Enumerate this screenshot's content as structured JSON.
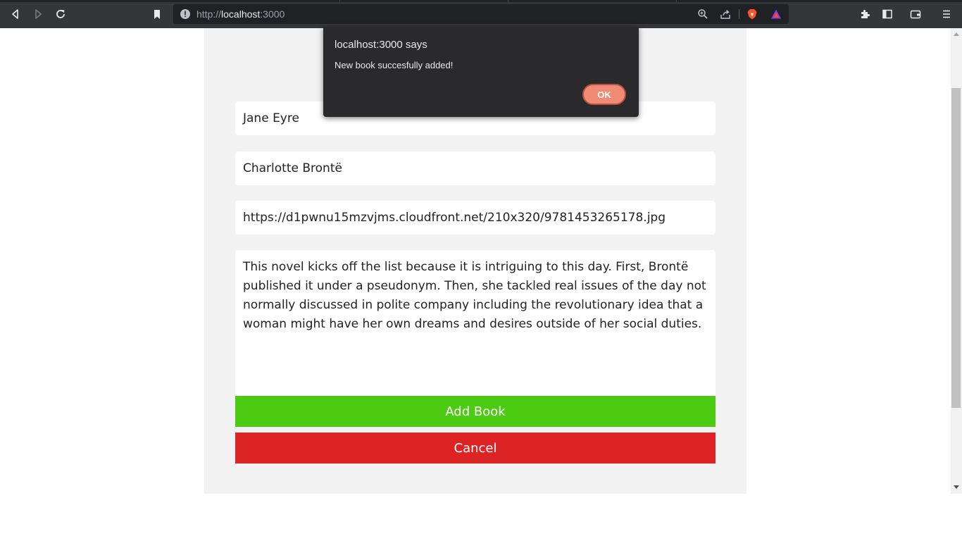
{
  "browser": {
    "url_prefix": "http://",
    "url_host": "localhost",
    "url_port": ":3000",
    "icons": {
      "back": "back-icon",
      "forward": "forward-icon",
      "reload": "reload-icon",
      "bookmark": "bookmark-icon",
      "site_info": "info-icon",
      "zoom": "zoom-icon",
      "share": "share-icon",
      "brave_shields": "brave-lion-icon",
      "brave_rewards": "rewards-triangle-icon",
      "extensions": "puzzle-icon",
      "sidebar": "sidebar-icon",
      "wallet": "wallet-icon",
      "menu": "menu-icon"
    }
  },
  "form": {
    "title_value": "Jane Eyre",
    "author_value": "Charlotte Brontë",
    "image_url_value": "https://d1pwnu15mzvjms.cloudfront.net/210x320/9781453265178.jpg",
    "description_value": "This novel kicks off the list because it is intriguing to this day. First, Brontë published it under a pseudonym. Then, she tackled real issues of the day not normally discussed in polite company including the revolutionary idea that a woman might have her own dreams and desires outside of her social duties.",
    "add_button": "Add Book",
    "cancel_button": "Cancel"
  },
  "dialog": {
    "title": "localhost:3000 says",
    "message": "New book succesfully added!",
    "ok_button": "OK"
  },
  "colors": {
    "add_button": "#4ccb12",
    "cancel_button": "#dd2424",
    "dialog_ok": "#f28b75",
    "panel": "#f2f2f2"
  }
}
